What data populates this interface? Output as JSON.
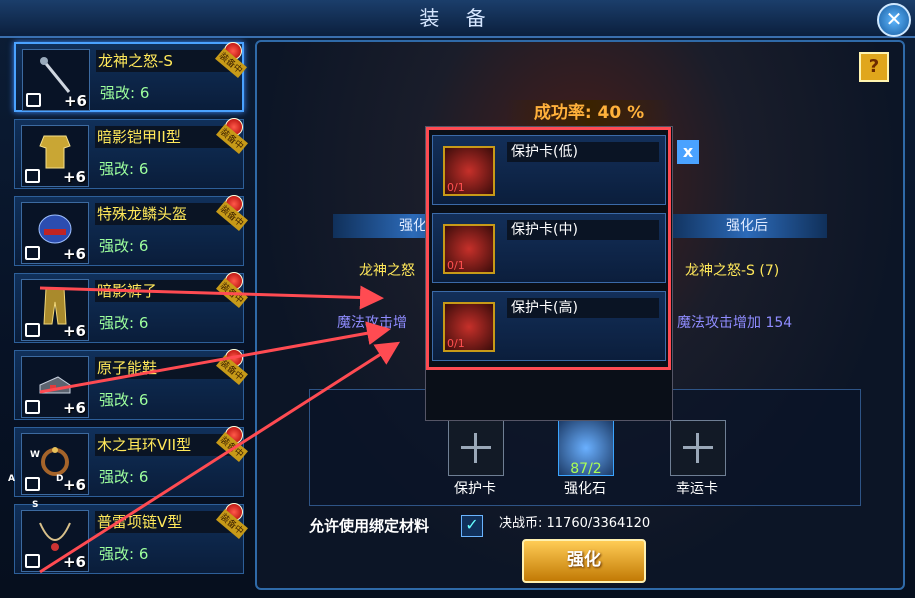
{
  "window": {
    "title": "装 备",
    "close_label": "✕"
  },
  "items": [
    {
      "name": "龙神之怒-S",
      "level": "强改: 6",
      "plus": "+6",
      "badge": "装备中",
      "icon": "staff-icon",
      "selected": true
    },
    {
      "name": "暗影铠甲II型",
      "level": "强改: 6",
      "plus": "+6",
      "badge": "装备中",
      "icon": "armor-icon",
      "selected": false
    },
    {
      "name": "特殊龙鳞头盔",
      "level": "强改: 6",
      "plus": "+6",
      "badge": "装备中",
      "icon": "helmet-icon",
      "selected": false
    },
    {
      "name": "暗影裤子",
      "level": "强改: 6",
      "plus": "+6",
      "badge": "装备中",
      "icon": "pants-icon",
      "selected": false
    },
    {
      "name": "原子能鞋",
      "level": "强改: 6",
      "plus": "+6",
      "badge": "装备中",
      "icon": "boots-icon",
      "selected": false
    },
    {
      "name": "木之耳环VII型",
      "level": "强改: 6",
      "plus": "+6",
      "badge": "装备中",
      "icon": "earring-icon",
      "selected": false
    },
    {
      "name": "普雷项链V型",
      "level": "强改: 6",
      "plus": "+6",
      "badge": "装备中",
      "icon": "necklace-icon",
      "selected": false
    }
  ],
  "main": {
    "help_label": "?",
    "success_rate": "成功率: 40 %",
    "before_header": "强化",
    "after_header": "强化后",
    "before_name": "龙神之怒",
    "after_name": "龙神之怒-S (7)",
    "before_stat": "魔法攻击增",
    "after_stat": "魔法攻击增加 154",
    "slots": [
      {
        "label": "保护卡",
        "count": ""
      },
      {
        "label": "强化石",
        "count": "87/2"
      },
      {
        "label": "幸运卡",
        "count": ""
      }
    ],
    "allow_bound": "允许使用绑定材料",
    "allow_checked": true,
    "coins": "决战币: 11760/3364120",
    "enhance_button": "强化"
  },
  "dropdown": {
    "close_label": "x",
    "options": [
      {
        "name": "保护卡(低)",
        "qty": "0/1"
      },
      {
        "name": "保护卡(中)",
        "qty": "0/1"
      },
      {
        "name": "保护卡(高)",
        "qty": "0/1"
      }
    ]
  },
  "overlay_keys": {
    "w": "W",
    "a": "A",
    "s": "S",
    "d": "D"
  },
  "colors": {
    "item_name": "#ffe85a",
    "item_level": "#9dff9d",
    "stat": "#8f8cff",
    "annotation_red": "#ff4b52",
    "accent_gold": "#ffb13b"
  }
}
